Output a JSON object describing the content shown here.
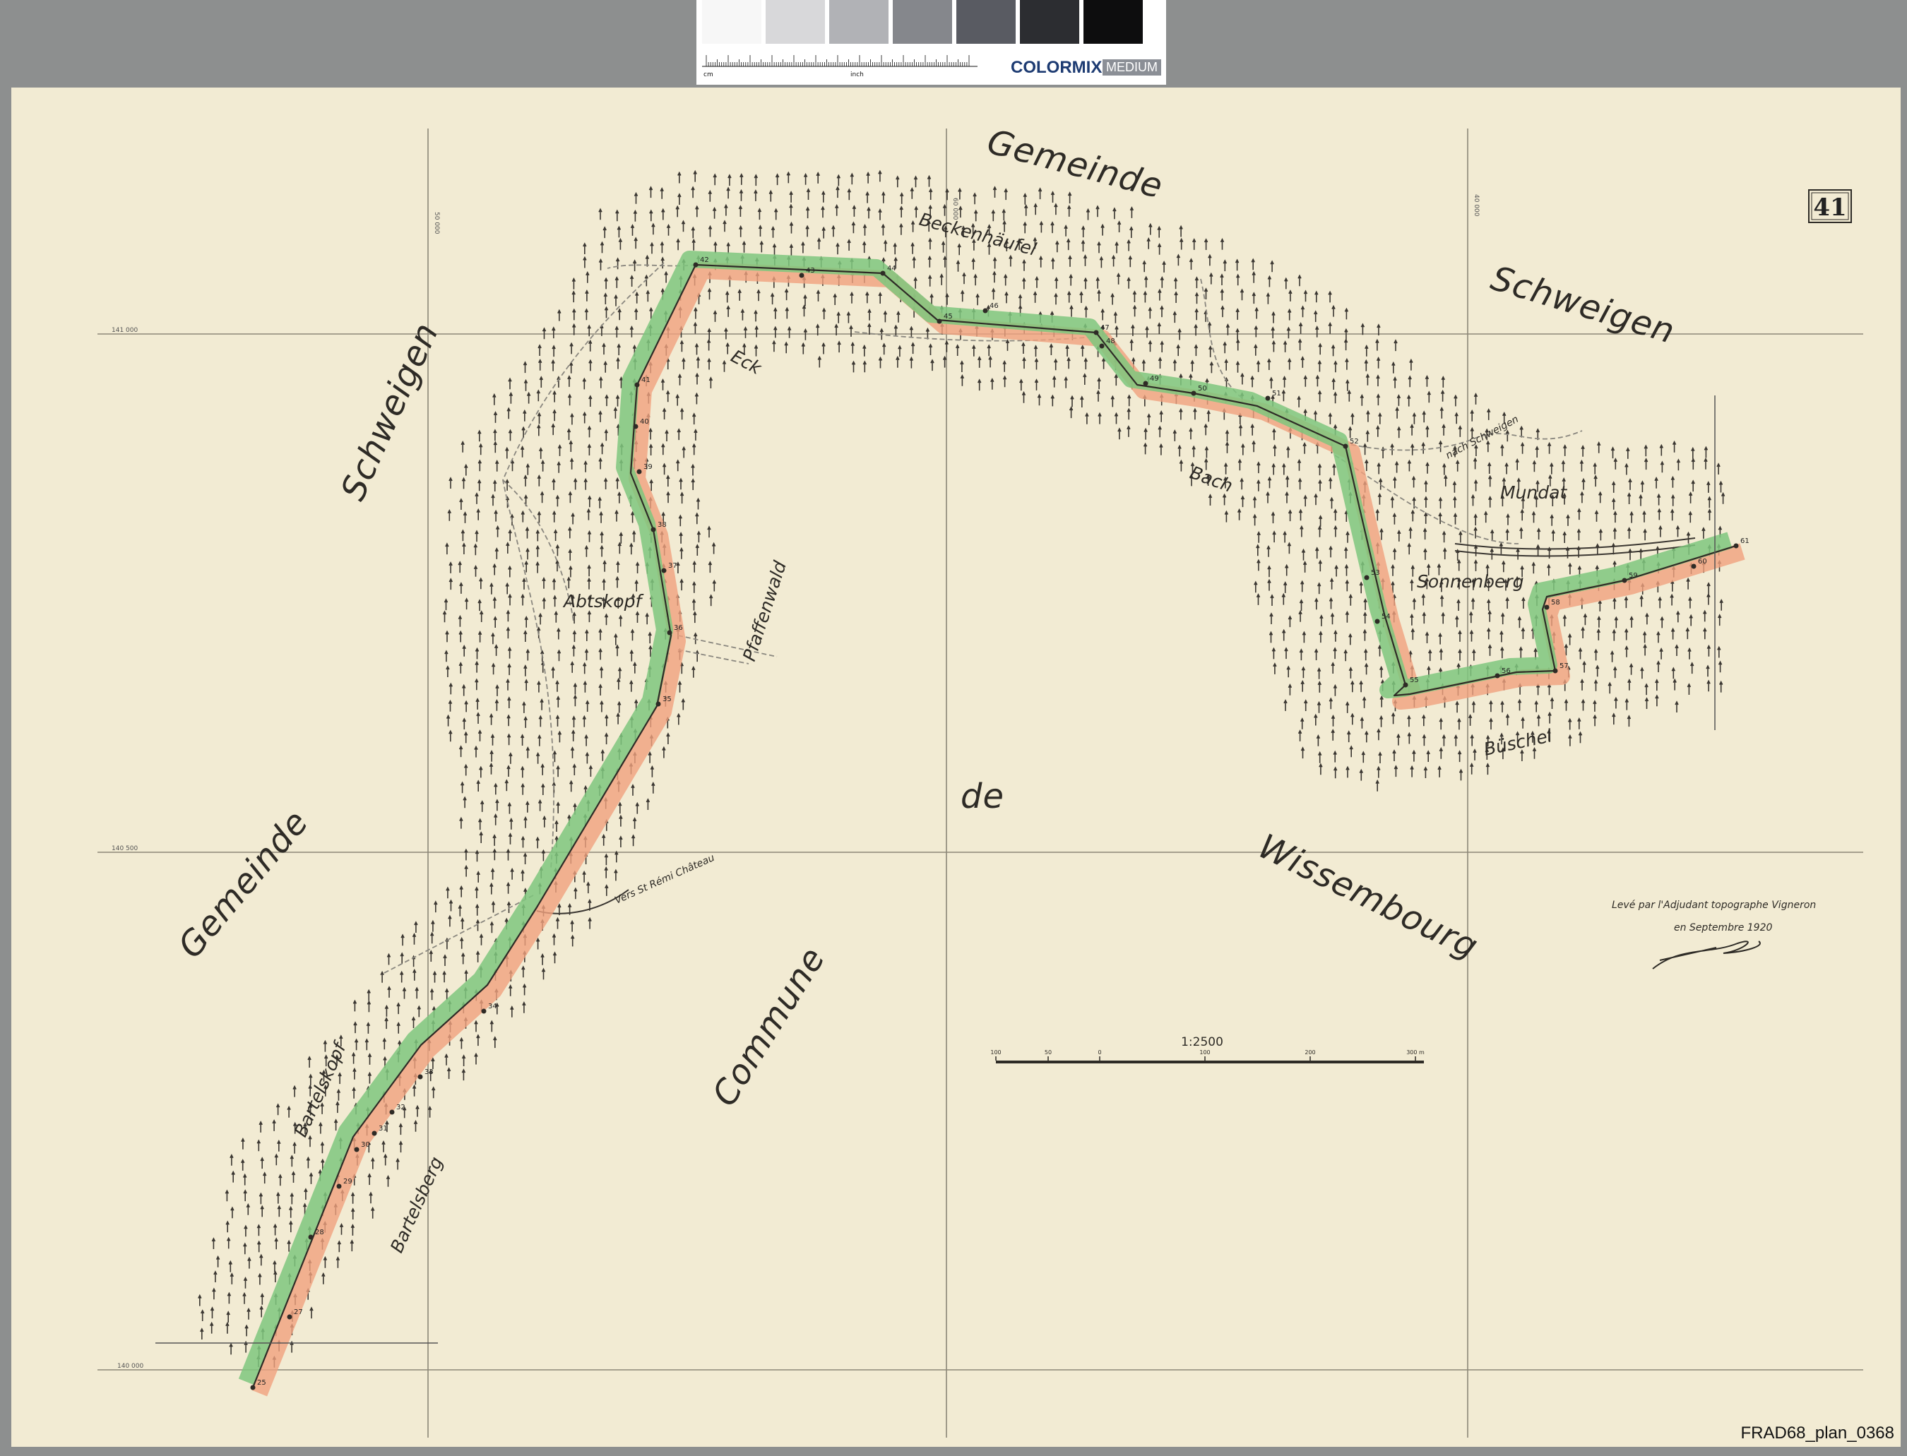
{
  "calibration": {
    "swatch_colors": [
      "#f7f7f7",
      "#d8d8da",
      "#b1b2b6",
      "#85878c",
      "#595b62",
      "#2c2d31",
      "#0d0d0e"
    ],
    "units": [
      "cm",
      "inch"
    ],
    "brand": "COLORMIX",
    "size": "MEDIUM"
  },
  "sheet": {
    "number": "41",
    "colors": {
      "paper": "#f2ebd3",
      "grid": "#8c8778",
      "ink": "#2e2b26",
      "green_band": "#7fc77e",
      "red_band": "#f0a17e"
    }
  },
  "labels": {
    "gemeinde_top": "Gemeinde",
    "schweigen_right": "Schweigen",
    "schweigen_left": "Schweigen",
    "gemeinde_left": "Gemeinde",
    "commune": "Commune",
    "de": "de",
    "wissembourg": "Wissembourg",
    "beckenhaufel": "Beckenhäufel",
    "eck": "Eck",
    "abtskopf": "Abtskopf",
    "pfaffenwald": "Pfaffenwald",
    "bach": "Bach",
    "mundat": "Mundat",
    "sonnenberg": "Sonnenberg",
    "buschel": "Büschel",
    "bartelskopf": "Bartelskopf",
    "bartelsberg": "Bartelsberg",
    "vers_st_remy": "Vers St Rémi Château",
    "nach_schweigen": "nach Schweigen"
  },
  "coordinates": {
    "col1": "50 000",
    "col2": "60 000",
    "col3": "40 000",
    "row1": "141 000",
    "row2": "140 500",
    "row3": "140 000"
  },
  "surveyor": {
    "line1": "Levé par l'Adjudant topographe Vigneron",
    "line2": "en Septembre 1920"
  },
  "scale": {
    "ratio": "1:2500",
    "ticks": [
      "100",
      "50",
      "0",
      "100",
      "200",
      "300 m"
    ]
  },
  "boundary_markers": [
    "25",
    "27",
    "28",
    "29",
    "30",
    "31",
    "32",
    "33",
    "34",
    "35",
    "36",
    "37",
    "38",
    "39",
    "40",
    "41",
    "42",
    "43",
    "44",
    "45",
    "46",
    "47",
    "48",
    "49",
    "50",
    "51",
    "52",
    "53",
    "54",
    "55",
    "56",
    "57",
    "58",
    "59",
    "60",
    "61"
  ],
  "archive_ref": "FRAD68_plan_0368"
}
